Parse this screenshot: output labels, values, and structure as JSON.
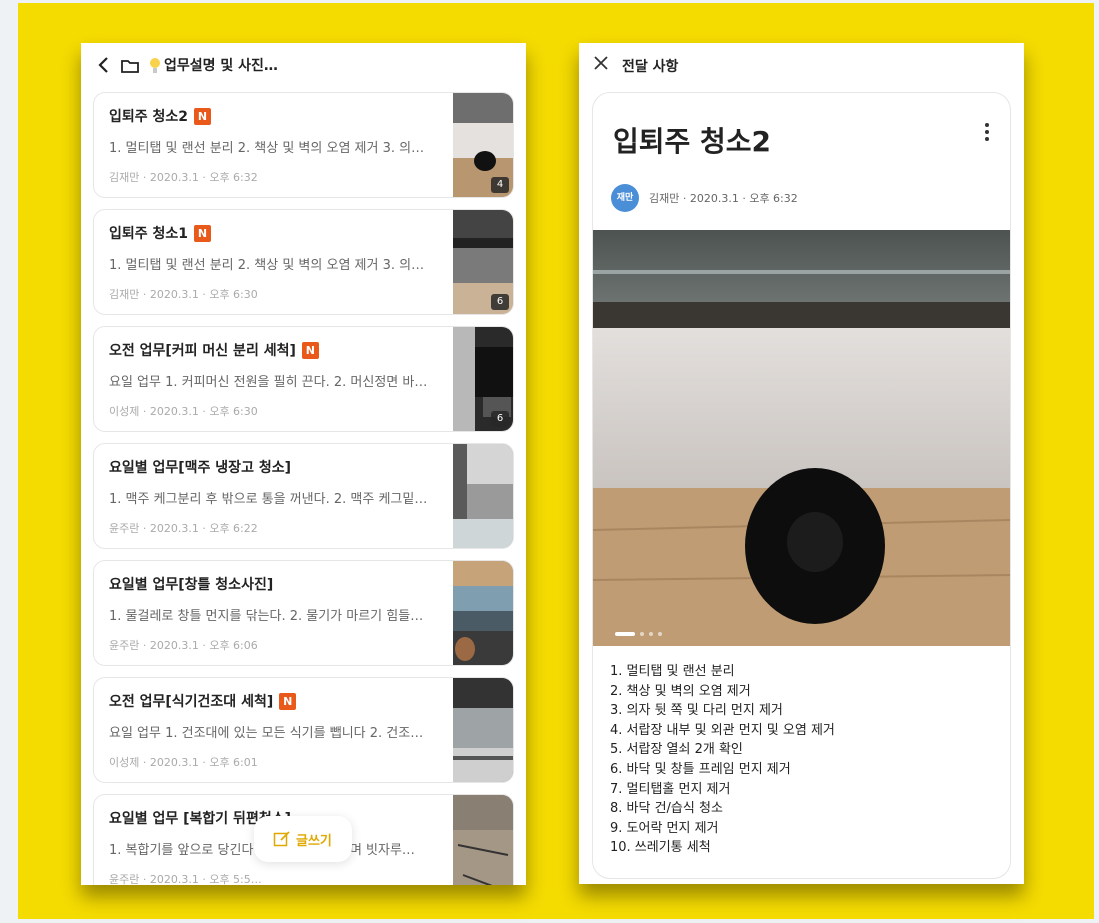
{
  "left": {
    "header": {
      "back_icon": "chevron-left-icon",
      "folder_icon": "folder-icon",
      "bulb_icon": "lightbulb-icon",
      "title": "업무설명 및 사진…"
    },
    "posts": [
      {
        "title": "입퇴주 청소2",
        "new": true,
        "badge": "N",
        "excerpt": "1. 멀티탭 및 랜선 분리 2. 책상 및 벽의 오염 제거 3. 의…",
        "meta": "김재만 · 2020.3.1 · 오후 6:32",
        "count": "4"
      },
      {
        "title": "입퇴주 청소1",
        "new": true,
        "badge": "N",
        "excerpt": "1. 멀티탭 및 랜선 분리 2. 책상 및 벽의 오염 제거 3. 의…",
        "meta": "김재만 · 2020.3.1 · 오후 6:30",
        "count": "6"
      },
      {
        "title": "오전 업무[커피 머신 분리 세척]",
        "new": true,
        "badge": "N",
        "excerpt": "요일 업무 1. 커피머신 전원을 필히 끈다. 2. 머신정면 바…",
        "meta": "이성제 · 2020.3.1 · 오후 6:30",
        "count": "6"
      },
      {
        "title": "요일별 업무[맥주 냉장고 청소]",
        "new": false,
        "badge": "",
        "excerpt": "1. 맥주 케그분리 후 밖으로 통을 꺼낸다. 2. 맥주 케그밑…",
        "meta": "윤주란 · 2020.3.1 · 오후 6:22",
        "count": ""
      },
      {
        "title": "요일별 업무[창틀 청소사진]",
        "new": false,
        "badge": "",
        "excerpt": "1. 물걸레로 창틀 먼지를 닦는다. 2. 물기가 마르기 힘들…",
        "meta": "윤주란 · 2020.3.1 · 오후 6:06",
        "count": ""
      },
      {
        "title": "오전 업무[식기건조대 세척]",
        "new": true,
        "badge": "N",
        "excerpt": "요일 업무 1. 건조대에 있는 모든 식기를 뺍니다 2. 건조…",
        "meta": "이성제 · 2020.3.1 · 오후 6:01",
        "count": ""
      },
      {
        "title": "요일별 업무 [복합기 뒤편청소]",
        "new": false,
        "badge": "",
        "excerpt": "1. 복합기를 앞으로 당긴다 2. 선정리를 해가며 빗자루…",
        "meta": "윤주란 · 2020.3.1 · 오후 5:5…",
        "count": ""
      }
    ],
    "write_button": {
      "label": "글쓰기",
      "icon": "edit-icon"
    }
  },
  "right": {
    "header": {
      "close_icon": "close-icon",
      "title": "전달 사항"
    },
    "post": {
      "title": "입퇴주 청소2",
      "more_icon": "more-vertical-icon",
      "avatar_text": "재만",
      "meta": "김재만 · 2020.3.1 · 오후 6:32",
      "body": [
        "1. 멀티탭 및 랜선 분리",
        "2. 책상 및 벽의 오염 제거",
        "3. 의자 뒷 쪽 및 다리 먼지 제거",
        "4. 서랍장 내부 및 외관 먼지 및 오염 제거",
        "5. 서랍장 열쇠 2개 확인",
        "6. 바닥 및 창틀 프레임 먼지 제거",
        "7. 멀티탭홀 먼지 제거",
        "8. 바닥 건/습식 청소",
        "9. 도어락 먼지 제거",
        "10. 쓰레기통 세척"
      ]
    }
  },
  "colors": {
    "background_frame": "#f5dc00",
    "new_badge": "#e8591a",
    "avatar": "#4a8ed8",
    "write_accent": "#e0a800"
  }
}
